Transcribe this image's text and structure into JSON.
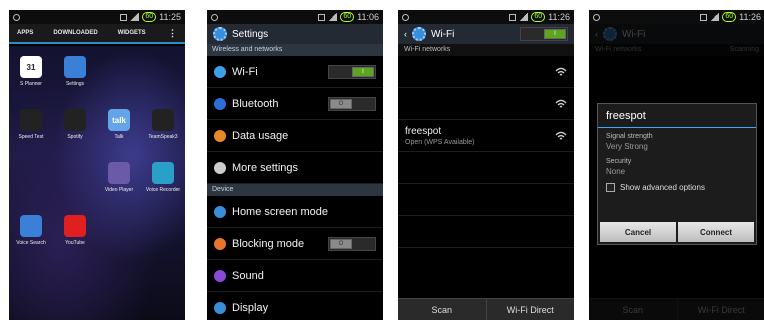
{
  "screens": {
    "drawer": {
      "status_time": "11:25",
      "tabs": [
        "APPS",
        "DOWNLOADED",
        "WIDGETS"
      ],
      "apps": [
        {
          "label": "S Planner",
          "icon": "calendar-icon",
          "color": "#ffffff",
          "text": "31"
        },
        {
          "label": "Settings",
          "icon": "gear-icon",
          "color": "#3a7fd8",
          "text": ""
        },
        {
          "label": "",
          "icon": "",
          "color": "transparent",
          "text": ""
        },
        {
          "label": "",
          "icon": "",
          "color": "transparent",
          "text": ""
        },
        {
          "label": "Speed Test",
          "icon": "speedometer-icon",
          "color": "#222222",
          "text": ""
        },
        {
          "label": "Spotify",
          "icon": "spotify-icon",
          "color": "#222222",
          "text": ""
        },
        {
          "label": "Talk",
          "icon": "talk-icon",
          "color": "#63a5e8",
          "text": "talk"
        },
        {
          "label": "TeamSpeak3",
          "icon": "teamspeak-icon",
          "color": "#222222",
          "text": ""
        },
        {
          "label": "",
          "icon": "",
          "color": "transparent",
          "text": ""
        },
        {
          "label": "",
          "icon": "",
          "color": "transparent",
          "text": ""
        },
        {
          "label": "Video Player",
          "icon": "video-player-icon",
          "color": "#6a5aa8",
          "text": ""
        },
        {
          "label": "Voice Recorder",
          "icon": "voice-recorder-icon",
          "color": "#2a9fc8",
          "text": ""
        },
        {
          "label": "Voice Search",
          "icon": "microphone-icon",
          "color": "#3a7fd8",
          "text": ""
        },
        {
          "label": "YouTube",
          "icon": "youtube-icon",
          "color": "#e02020",
          "text": ""
        }
      ]
    },
    "settings": {
      "status_time": "11:06",
      "title": "Settings",
      "section1": "Wireless and networks",
      "section2": "Device",
      "rows": [
        {
          "label": "Wi-Fi",
          "icon": "wifi-icon",
          "color": "#3aa0e8",
          "toggle": "on",
          "toggle_text": "I"
        },
        {
          "label": "Bluetooth",
          "icon": "bluetooth-icon",
          "color": "#2a6fd8",
          "toggle": "off",
          "toggle_text": "O"
        },
        {
          "label": "Data usage",
          "icon": "data-usage-icon",
          "color": "#e88a2a",
          "toggle": "",
          "toggle_text": ""
        },
        {
          "label": "More settings",
          "icon": "more-icon",
          "color": "#cccccc",
          "toggle": "",
          "toggle_text": ""
        }
      ],
      "device_rows": [
        {
          "label": "Home screen mode",
          "icon": "home-icon",
          "color": "#3a8dd8",
          "toggle": "",
          "toggle_text": ""
        },
        {
          "label": "Blocking mode",
          "icon": "block-icon",
          "color": "#e8752a",
          "toggle": "off",
          "toggle_text": "O"
        },
        {
          "label": "Sound",
          "icon": "sound-icon",
          "color": "#8a4ad8",
          "toggle": "",
          "toggle_text": ""
        },
        {
          "label": "Display",
          "icon": "display-icon",
          "color": "#3a8dd8",
          "toggle": "",
          "toggle_text": ""
        }
      ]
    },
    "wifi": {
      "status_time": "11:26",
      "title": "Wi-Fi",
      "toggle_text": "I",
      "section": "Wi-Fi networks",
      "networks": [
        {
          "name": "",
          "status": ""
        },
        {
          "name": "",
          "status": ""
        },
        {
          "name": "freespot",
          "status": "Open (WPS Available)"
        }
      ],
      "scan": "Scan",
      "direct": "Wi-Fi Direct"
    },
    "dialog": {
      "status_time": "11:26",
      "title": "Wi-Fi",
      "section": "Wi-Fi networks",
      "scanning": "Scanning",
      "ssid": "freespot",
      "signal_label": "Signal strength",
      "signal_value": "Very Strong",
      "security_label": "Security",
      "security_value": "None",
      "advanced": "Show advanced options",
      "cancel": "Cancel",
      "connect": "Connect",
      "scan": "Scan",
      "direct": "Wi-Fi Direct"
    }
  }
}
